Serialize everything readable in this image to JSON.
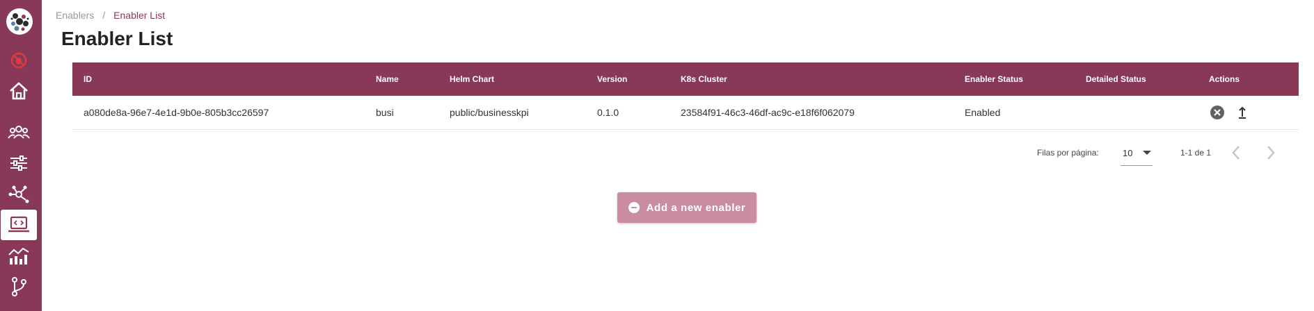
{
  "sidebar": {
    "items": [
      {
        "icon": "logo-icon"
      },
      {
        "icon": "no-bug-icon"
      },
      {
        "icon": "home-icon"
      },
      {
        "icon": "users-icon"
      },
      {
        "icon": "sliders-icon"
      },
      {
        "icon": "network-icon"
      },
      {
        "icon": "laptop-code-icon",
        "active": true
      },
      {
        "icon": "analytics-icon"
      },
      {
        "icon": "git-branch-icon"
      }
    ],
    "background": "#873957"
  },
  "breadcrumb": {
    "parent": "Enablers",
    "separator": "/",
    "current": "Enabler List"
  },
  "page": {
    "title": "Enabler List"
  },
  "table": {
    "columns": [
      "ID",
      "Name",
      "Helm Chart",
      "Version",
      "K8s Cluster",
      "Enabler Status",
      "Detailed Status",
      "Actions"
    ],
    "rows": [
      {
        "id": "a080de8a-96e7-4e1d-9b0e-805b3cc26597",
        "name": "busi",
        "helm_chart": "public/businesskpi",
        "version": "0.1.0",
        "k8s_cluster": "23584f91-46c3-46df-ac9c-e18f6f062079",
        "enabler_status": "Enabled",
        "detailed_status": "",
        "actions": [
          "delete-icon",
          "upgrade-icon"
        ]
      }
    ]
  },
  "pagination": {
    "rows_per_page_label": "Filas por página:",
    "rows_per_page_value": "10",
    "range_text": "1-1 de 1"
  },
  "add_button": {
    "label": "Add a new enabler",
    "icon": "minus-circle-icon"
  },
  "colors": {
    "brand": "#873957",
    "add_button": "#c98ca3",
    "active_bg": "#ffffff"
  }
}
